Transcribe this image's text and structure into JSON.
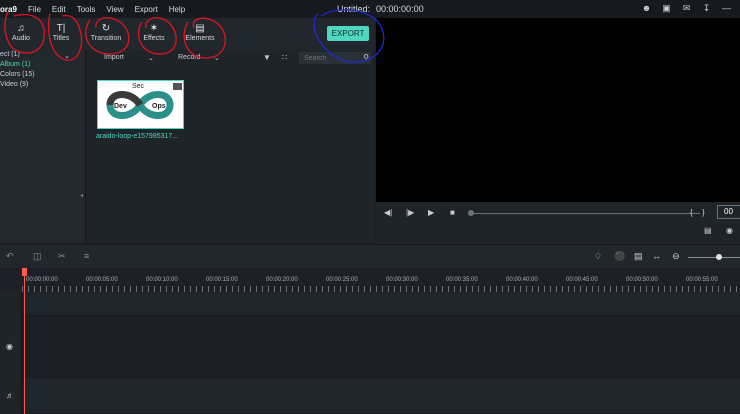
{
  "app": {
    "logo": "ora9",
    "menu": [
      "File",
      "Edit",
      "Tools",
      "View",
      "Export",
      "Help"
    ],
    "title": "Untitled:",
    "timecode": "00:00:00:00"
  },
  "toolbar": {
    "tabs": [
      {
        "label": "Audio",
        "icon": "music-note-icon"
      },
      {
        "label": "Titles",
        "icon": "text-icon"
      },
      {
        "label": "Transition",
        "icon": "transition-icon"
      },
      {
        "label": "Effects",
        "icon": "sparkle-icon"
      },
      {
        "label": "Elements",
        "icon": "image-icon"
      }
    ],
    "export_label": "EXPORT"
  },
  "media_tree": {
    "items": [
      {
        "label": "ect (1)",
        "active": false
      },
      {
        "label": "Album (1)",
        "active": true
      },
      {
        "label": "Colors (15)",
        "active": false
      },
      {
        "label": "Video (9)",
        "active": false
      }
    ]
  },
  "media": {
    "import_label": "Import",
    "record_label": "Record",
    "search_placeholder": "Search",
    "items": [
      {
        "caption": "araido-loop-e157985317...",
        "thumb_text": [
          "Sec",
          "Dev",
          "Ops"
        ]
      }
    ]
  },
  "preview": {
    "time": "00"
  },
  "timeline": {
    "ruler": [
      "00:00:00:00",
      "00:00:05:00",
      "00:00:10:00",
      "00:00:15:00",
      "00:00:20:00",
      "00:00:25:00",
      "00:00:30:00",
      "00:00:35:00",
      "00:00:40:00",
      "00:00:45:00",
      "00:00:50:00",
      "00:00:55:00"
    ]
  },
  "colors": {
    "accent": "#4fd8c1",
    "playhead": "#ff5a4a",
    "annotation_red": "#e0141e",
    "annotation_blue": "#1c2ccc"
  }
}
